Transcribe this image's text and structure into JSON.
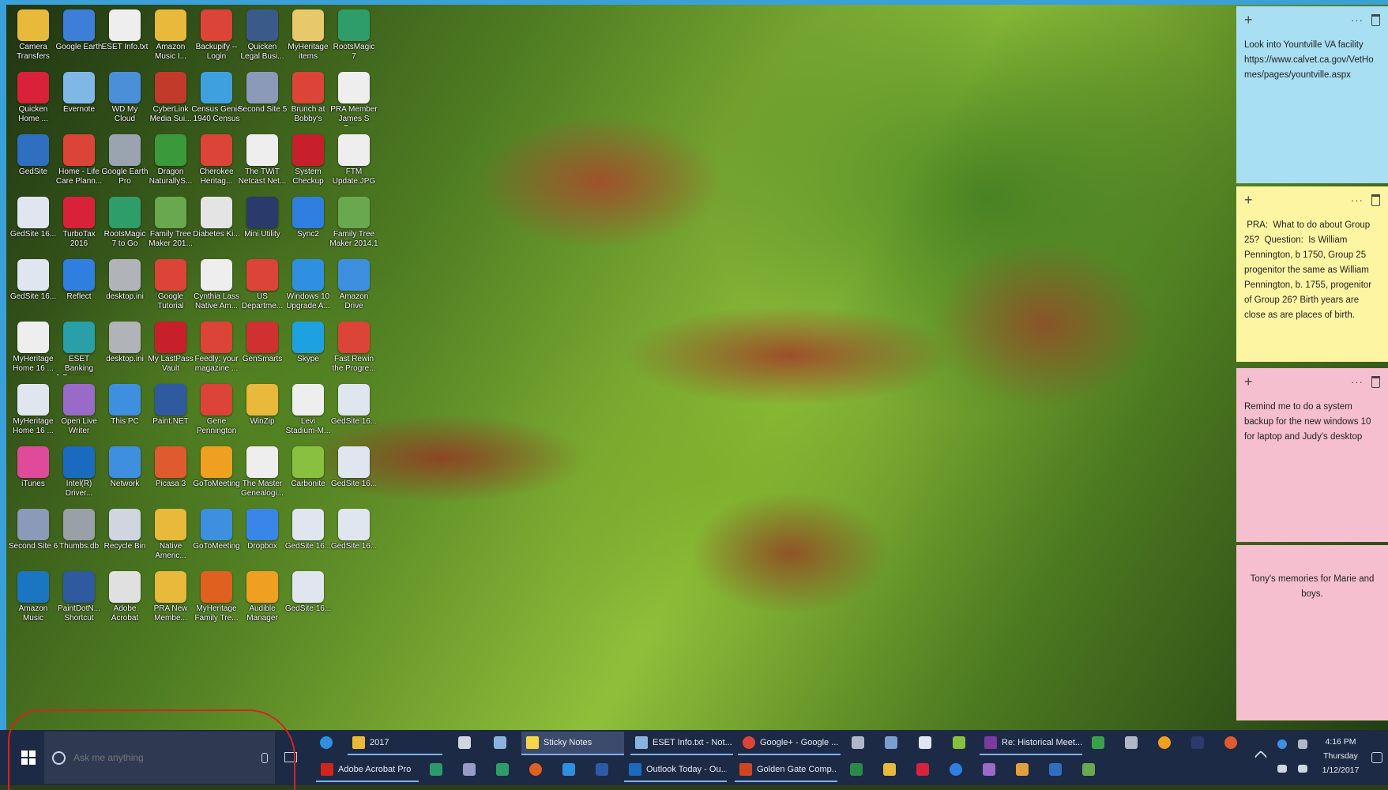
{
  "desktop": {
    "icons": [
      {
        "label": "Camera\nTransfers",
        "icon": "folder-icon",
        "color": "#e8b93a",
        "col": 0,
        "row": 0
      },
      {
        "label": "Google Earth",
        "icon": "globe-icon",
        "color": "#3d7fd8",
        "col": 1,
        "row": 0
      },
      {
        "label": "ESET Info.txt",
        "icon": "document-icon",
        "color": "#eeeeee",
        "col": 2,
        "row": 0
      },
      {
        "label": "Amazon\nMusic I...",
        "icon": "folder-icon",
        "color": "#e8b93a",
        "col": 3,
        "row": 0
      },
      {
        "label": "Backupify --\nLogin",
        "icon": "chrome-icon",
        "color": "#db4437",
        "col": 4,
        "row": 0
      },
      {
        "label": "Quicken\nLegal Busi...",
        "icon": "app-icon",
        "color": "#3a5a8a",
        "col": 5,
        "row": 0
      },
      {
        "label": "MyHeritage\nitems",
        "icon": "folder-icon",
        "color": "#e8c96a",
        "col": 6,
        "row": 0
      },
      {
        "label": "RootsMagic\n7",
        "icon": "tree-icon",
        "color": "#2f9d6a",
        "col": 7,
        "row": 0
      },
      {
        "label": "Quicken\nHome ...",
        "icon": "quicken-icon",
        "color": "#d9223a",
        "col": 0,
        "row": 1
      },
      {
        "label": "Evernote",
        "icon": "image-icon",
        "color": "#7fb8e6",
        "col": 1,
        "row": 1
      },
      {
        "label": "WD My\nCloud",
        "icon": "cloud-icon",
        "color": "#4a8fd8",
        "col": 2,
        "row": 1
      },
      {
        "label": "CyberLink\nMedia Sui...",
        "icon": "app-icon",
        "color": "#c23a2a",
        "col": 3,
        "row": 1
      },
      {
        "label": "Census Genie\n1940 Census",
        "icon": "ie-icon",
        "color": "#3fa0e0",
        "col": 4,
        "row": 1
      },
      {
        "label": "Second Site 5",
        "icon": "gear-icon",
        "color": "#8a9ab8",
        "col": 5,
        "row": 1
      },
      {
        "label": "Brunch at\nBobby's",
        "icon": "chrome-icon",
        "color": "#db4437",
        "col": 6,
        "row": 1
      },
      {
        "label": "PRA Member\nJames S Pen...",
        "icon": "document-icon",
        "color": "#eeeeee",
        "col": 7,
        "row": 1
      },
      {
        "label": "GedSite",
        "icon": "app-icon",
        "color": "#2f6fc0",
        "col": 0,
        "row": 2
      },
      {
        "label": "Home - Life\nCare Plann...",
        "icon": "chrome-icon",
        "color": "#db4437",
        "col": 1,
        "row": 2
      },
      {
        "label": "Google Earth\nPro",
        "icon": "globe-icon",
        "color": "#9aa4b0",
        "col": 2,
        "row": 2
      },
      {
        "label": "Dragon\nNaturallyS...",
        "icon": "dragon-icon",
        "color": "#3a9a3a",
        "col": 3,
        "row": 2
      },
      {
        "label": "Cherokee\nHeritag...",
        "icon": "chrome-icon",
        "color": "#db4437",
        "col": 4,
        "row": 2
      },
      {
        "label": "The TWiT\nNetcast Net...",
        "icon": "document-icon",
        "color": "#eeeeee",
        "col": 5,
        "row": 2
      },
      {
        "label": "System\nCheckup",
        "icon": "check-icon",
        "color": "#c8202a",
        "col": 6,
        "row": 2
      },
      {
        "label": "FTM\nUpdate.JPG",
        "icon": "image-icon",
        "color": "#eeeeee",
        "col": 7,
        "row": 2
      },
      {
        "label": "GedSite 16...",
        "icon": "document-icon",
        "color": "#dfe6f0",
        "col": 0,
        "row": 3
      },
      {
        "label": "TurboTax\n2016",
        "icon": "check-icon",
        "color": "#d9223a",
        "col": 1,
        "row": 3
      },
      {
        "label": "RootsMagic\n7 to Go",
        "icon": "tree-icon",
        "color": "#2f9d6a",
        "col": 2,
        "row": 3
      },
      {
        "label": "Family Tree\nMaker 201...",
        "icon": "tree-icon",
        "color": "#6aa84f",
        "col": 3,
        "row": 3
      },
      {
        "label": "Diabetes Ki...",
        "icon": "pdf-icon",
        "color": "#e4e4e4",
        "col": 4,
        "row": 3
      },
      {
        "label": "Mini Utility",
        "icon": "calculator-icon",
        "color": "#2a3a6a",
        "col": 5,
        "row": 3
      },
      {
        "label": "Sync2",
        "icon": "sync-icon",
        "color": "#2f7fe0",
        "col": 6,
        "row": 3
      },
      {
        "label": "Family Tree\nMaker 2014.1",
        "icon": "tree-icon",
        "color": "#6aa84f",
        "col": 7,
        "row": 3
      },
      {
        "label": "GedSite 16...",
        "icon": "document-icon",
        "color": "#dfe6f0",
        "col": 0,
        "row": 4
      },
      {
        "label": "Reflect",
        "icon": "app-icon",
        "color": "#2f7fe0",
        "col": 1,
        "row": 4
      },
      {
        "label": "desktop.ini",
        "icon": "document-icon",
        "color": "#b0b4b8",
        "col": 2,
        "row": 4
      },
      {
        "label": "Google\nTutorial",
        "icon": "chrome-icon",
        "color": "#db4437",
        "col": 3,
        "row": 4
      },
      {
        "label": "Cynthia Lass\nNative Am...",
        "icon": "document-icon",
        "color": "#eeeeee",
        "col": 4,
        "row": 4
      },
      {
        "label": "US\nDepartme...",
        "icon": "chrome-icon",
        "color": "#db4437",
        "col": 5,
        "row": 4
      },
      {
        "label": "Windows 10\nUpgrade A...",
        "icon": "windows-icon",
        "color": "#2f8fe0",
        "col": 6,
        "row": 4
      },
      {
        "label": "Amazon\nDrive",
        "icon": "cloud-icon",
        "color": "#3f8fe0",
        "col": 7,
        "row": 4
      },
      {
        "label": "MyHeritage\nHome 16 ...",
        "icon": "document-icon",
        "color": "#eeeeee",
        "col": 0,
        "row": 5
      },
      {
        "label": "ESET Banking\n& Payment ...",
        "icon": "shield-icon",
        "color": "#29a0a8",
        "col": 1,
        "row": 5
      },
      {
        "label": "desktop.ini",
        "icon": "document-icon",
        "color": "#b0b4b8",
        "col": 2,
        "row": 5
      },
      {
        "label": "My LastPass\nVault",
        "icon": "star-icon",
        "color": "#c8202a",
        "col": 3,
        "row": 5
      },
      {
        "label": "Feedly: your\nmagazine ...",
        "icon": "chrome-icon",
        "color": "#db4437",
        "col": 4,
        "row": 5
      },
      {
        "label": "GenSmarts",
        "icon": "app-icon",
        "color": "#d03030",
        "col": 5,
        "row": 5
      },
      {
        "label": "Skype",
        "icon": "skype-icon",
        "color": "#1ea1e0",
        "col": 6,
        "row": 5
      },
      {
        "label": "Fast Rewin\nthe Progre...",
        "icon": "chrome-icon",
        "color": "#db4437",
        "col": 7,
        "row": 5
      },
      {
        "label": "MyHeritage\nHome 16 ...",
        "icon": "document-icon",
        "color": "#dfe6f0",
        "col": 0,
        "row": 6
      },
      {
        "label": "Open Live\nWriter",
        "icon": "cloud-icon",
        "color": "#9a6ac8",
        "col": 1,
        "row": 6
      },
      {
        "label": "This PC",
        "icon": "computer-icon",
        "color": "#3f8fe0",
        "col": 2,
        "row": 6
      },
      {
        "label": "Paint.NET",
        "icon": "image-icon",
        "color": "#2f5aa0",
        "col": 3,
        "row": 6
      },
      {
        "label": "Gene\nPennington",
        "icon": "chrome-icon",
        "color": "#db4437",
        "col": 4,
        "row": 6
      },
      {
        "label": "WinZip",
        "icon": "folder-icon",
        "color": "#e8b93a",
        "col": 5,
        "row": 6
      },
      {
        "label": "Levi\nStadium-M...",
        "icon": "document-icon",
        "color": "#eeeeee",
        "col": 6,
        "row": 6
      },
      {
        "label": "GedSite 16...",
        "icon": "document-icon",
        "color": "#dfe6f0",
        "col": 7,
        "row": 6
      },
      {
        "label": "iTunes",
        "icon": "music-icon",
        "color": "#e04a9a",
        "col": 0,
        "row": 7
      },
      {
        "label": "Intel(R)\nDriver...",
        "icon": "app-icon",
        "color": "#1a6ac0",
        "col": 1,
        "row": 7
      },
      {
        "label": "Network",
        "icon": "network-icon",
        "color": "#3f8fe0",
        "col": 2,
        "row": 7
      },
      {
        "label": "Picasa 3",
        "icon": "app-icon",
        "color": "#e05a30",
        "col": 3,
        "row": 7
      },
      {
        "label": "GoToMeeting",
        "icon": "flower-icon",
        "color": "#f0a020",
        "col": 4,
        "row": 7
      },
      {
        "label": "The Master\nGenealogi...",
        "icon": "document-icon",
        "color": "#eeeeee",
        "col": 5,
        "row": 7
      },
      {
        "label": "Carbonite",
        "icon": "app-icon",
        "color": "#8ac040",
        "col": 6,
        "row": 7
      },
      {
        "label": "GedSite 16...",
        "icon": "document-icon",
        "color": "#dfe6f0",
        "col": 7,
        "row": 7
      },
      {
        "label": "Second Site 6",
        "icon": "gear-icon",
        "color": "#8a9ab8",
        "col": 0,
        "row": 8
      },
      {
        "label": "Thumbs.db",
        "icon": "document-icon",
        "color": "#9aa0a8",
        "col": 1,
        "row": 8
      },
      {
        "label": "Recycle Bin",
        "icon": "recycle-bin-icon",
        "color": "#cfd6e0",
        "col": 2,
        "row": 8
      },
      {
        "label": "Native\nAmeric...",
        "icon": "folder-icon",
        "color": "#e8b93a",
        "col": 3,
        "row": 8
      },
      {
        "label": "GoToMeeting",
        "icon": "flower-icon",
        "color": "#3f8fe0",
        "col": 4,
        "row": 8
      },
      {
        "label": "Dropbox",
        "icon": "dropbox-icon",
        "color": "#3a86e8",
        "col": 5,
        "row": 8
      },
      {
        "label": "GedSite 16...",
        "icon": "document-icon",
        "color": "#dfe6f0",
        "col": 6,
        "row": 8
      },
      {
        "label": "GedSite 16...",
        "icon": "document-icon",
        "color": "#dfe6f0",
        "col": 7,
        "row": 8
      },
      {
        "label": "Amazon\nMusic",
        "icon": "music-icon",
        "color": "#1a76c0",
        "col": 0,
        "row": 9
      },
      {
        "label": "PaintDotN...\nShortcut",
        "icon": "image-icon",
        "color": "#2f5aa0",
        "col": 1,
        "row": 9
      },
      {
        "label": "Adobe\nAcrobat",
        "icon": "pdf-icon",
        "color": "#e0e0e0",
        "col": 2,
        "row": 9
      },
      {
        "label": "PRA New\nMembe...",
        "icon": "folder-icon",
        "color": "#e8b93a",
        "col": 3,
        "row": 9
      },
      {
        "label": "MyHeritage\nFamily Tre...",
        "icon": "app-icon",
        "color": "#e06020",
        "col": 4,
        "row": 9
      },
      {
        "label": "Audible\nManager",
        "icon": "audible-icon",
        "color": "#f0a020",
        "col": 5,
        "row": 9
      },
      {
        "label": "GedSite 16...",
        "icon": "document-icon",
        "color": "#dfe6f0",
        "col": 6,
        "row": 9
      }
    ]
  },
  "sticky_notes": [
    {
      "text": "Look into Yountville VA facility\nhttps://www.calvet.ca.gov/VetHomes/pages/yountville.aspx",
      "color": "#a8dff2"
    },
    {
      "text": " PRA:  What to do about Group 25?  Question:  Is William Pennington, b 1750, Group 25 progenitor the same as William Pennington, b. 1755, progenitor of Group 26? Birth years are close as are places of birth.",
      "color": "#fdf5a2"
    },
    {
      "text": "Remind me to do a system backup for the new windows 10 for laptop and Judy's desktop",
      "color": "#f6bfd0"
    },
    {
      "text": "Tony's memories for Marie and boys.",
      "color": "#f6bfd0"
    }
  ],
  "taskbar": {
    "search_placeholder": "Ask me anything",
    "windows_top": [
      {
        "label": "2017",
        "icon": "folder-icon",
        "color": "#e8b93a",
        "active": false
      },
      {
        "label": "Sticky Notes",
        "icon": "sticky-notes-icon",
        "color": "#f5d54a",
        "active": true
      },
      {
        "label": "ESET Info.txt - Not...",
        "icon": "notepad-icon",
        "color": "#8ab4e0",
        "active": false
      },
      {
        "label": "Google+ - Google ...",
        "icon": "chrome-icon",
        "color": "#db4437",
        "active": false
      },
      {
        "label": "Re: Historical Meet...",
        "icon": "onenote-icon",
        "color": "#7a3aa0",
        "active": false
      }
    ],
    "windows_bottom": [
      {
        "label": "Adobe Acrobat Pro",
        "icon": "pdf-icon",
        "color": "#d0251f"
      },
      {
        "label": "Outlook Today - Ou...",
        "icon": "outlook-icon",
        "color": "#1a6ac0"
      },
      {
        "label": "Golden Gate Comp...",
        "icon": "powerpoint-icon",
        "color": "#d0441f"
      }
    ],
    "clock": {
      "time": "4:16 PM",
      "day": "Thursday",
      "date": "1/12/2017"
    },
    "colors": {
      "bar": "#1d2a45",
      "search": "#2f3a52",
      "accent": "#7fb2f0"
    }
  }
}
